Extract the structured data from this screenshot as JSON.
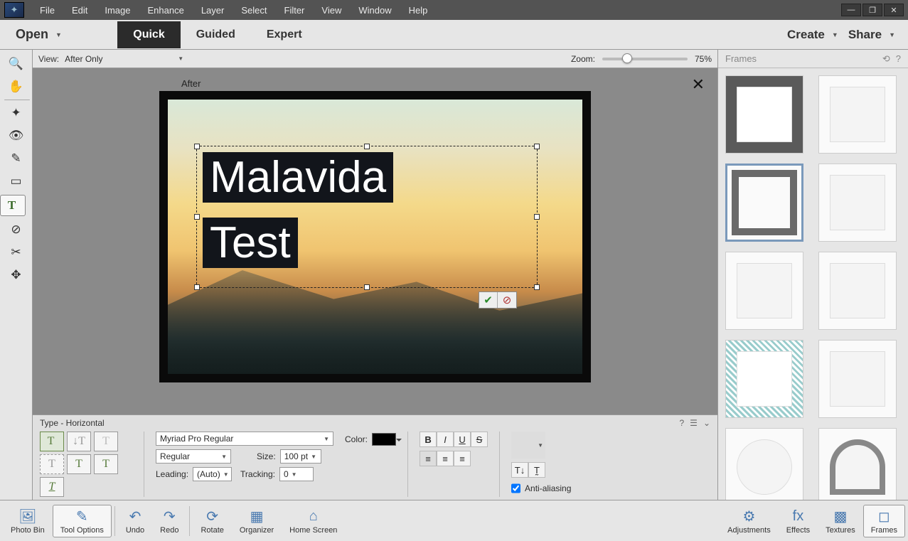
{
  "menu": {
    "items": [
      "File",
      "Edit",
      "Image",
      "Enhance",
      "Layer",
      "Select",
      "Filter",
      "View",
      "Window",
      "Help"
    ]
  },
  "win": {
    "min": "—",
    "max": "❐",
    "close": "✕"
  },
  "topbar": {
    "open": "Open",
    "modes": [
      "Quick",
      "Guided",
      "Expert"
    ],
    "active_mode": "Quick",
    "create": "Create",
    "share": "Share"
  },
  "viewbar": {
    "label": "View:",
    "option": "After Only",
    "zoom_label": "Zoom:",
    "zoom_value": "75%"
  },
  "canvas": {
    "after_label": "After",
    "text_line1": "Malavida",
    "text_line2": "Test"
  },
  "options": {
    "title": "Type - Horizontal",
    "font": "Myriad Pro Regular",
    "style": "Regular",
    "size_label": "Size:",
    "size": "100 pt",
    "leading_label": "Leading:",
    "leading": "(Auto)",
    "tracking_label": "Tracking:",
    "tracking": "0",
    "color_label": "Color:",
    "aa": "Anti-aliasing"
  },
  "frames": {
    "title": "Frames"
  },
  "status": {
    "left": [
      {
        "name": "photo-bin",
        "label": "Photo Bin",
        "icon": "🖼"
      },
      {
        "name": "tool-options",
        "label": "Tool Options",
        "icon": "✎",
        "sel": true
      },
      {
        "name": "undo",
        "label": "Undo",
        "icon": "↶"
      },
      {
        "name": "redo",
        "label": "Redo",
        "icon": "↷"
      },
      {
        "name": "rotate",
        "label": "Rotate",
        "icon": "⟳"
      },
      {
        "name": "organizer",
        "label": "Organizer",
        "icon": "▦"
      },
      {
        "name": "home",
        "label": "Home Screen",
        "icon": "⌂"
      }
    ],
    "right": [
      {
        "name": "adjustments",
        "label": "Adjustments",
        "icon": "⚙"
      },
      {
        "name": "effects",
        "label": "Effects",
        "icon": "fx"
      },
      {
        "name": "textures",
        "label": "Textures",
        "icon": "▩"
      },
      {
        "name": "frames",
        "label": "Frames",
        "icon": "◻",
        "sel": true
      }
    ]
  },
  "tools": [
    {
      "name": "zoom",
      "glyph": "🔍"
    },
    {
      "name": "hand",
      "glyph": "✋"
    },
    {
      "name": "sep"
    },
    {
      "name": "quick-select",
      "glyph": "✦"
    },
    {
      "name": "eye",
      "glyph": "👁"
    },
    {
      "name": "brush",
      "glyph": "✎"
    },
    {
      "name": "straighten",
      "glyph": "▭"
    },
    {
      "name": "type",
      "glyph": "T",
      "sel": true
    },
    {
      "name": "healing",
      "glyph": "⊘"
    },
    {
      "name": "crop",
      "glyph": "✂"
    },
    {
      "name": "move",
      "glyph": "✥"
    }
  ]
}
